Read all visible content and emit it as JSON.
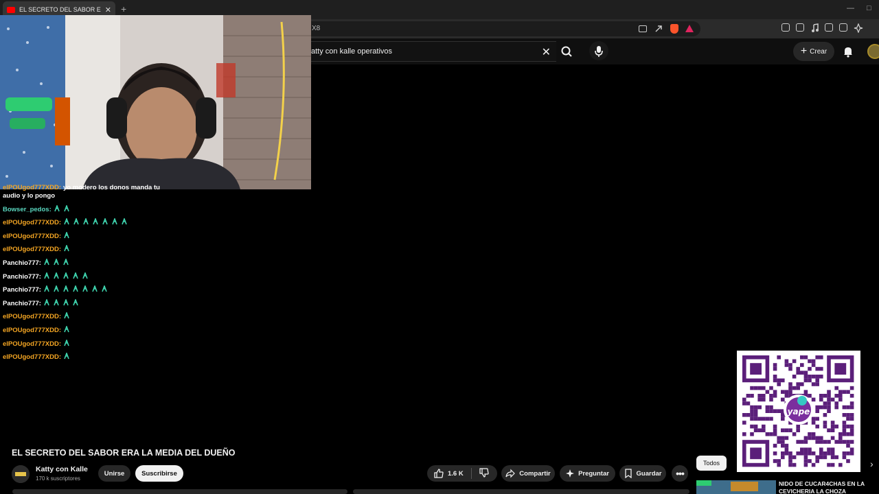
{
  "browser": {
    "tab_title": "EL SECRETO DEL SABOR ERA LA M",
    "tab_close": "✕",
    "new_tab": "+",
    "url_fragment": "X8"
  },
  "youtube": {
    "search_query": "atty con kalle operativos",
    "create_label": "Crear",
    "video_title": "EL SECRETO DEL SABOR ERA LA MEDIA DEL DUEÑO",
    "channel_name": "Katty con Kalle",
    "subscribers": "170 k suscriptores",
    "join_label": "Unirse",
    "subscribe_label": "Suscribirse",
    "like_count": "1.6 K",
    "share_label": "Compartir",
    "ask_label": "Preguntar",
    "save_label": "Guardar",
    "filter_all": "Todos",
    "recommended_title": "NIDO DE CUCAR4CHAS EN LA CEVICHERIA LA  CHOZA"
  },
  "chat": {
    "messages": [
      {
        "user": "elPOUgod777XDD:",
        "color": "orange",
        "text": "yo modero los donos manda tu audio y lo pongo",
        "emotes": 0
      },
      {
        "user": "Bowser_pedos:",
        "color": "green",
        "text": "",
        "emotes": 2
      },
      {
        "user": "elPOUgod777XDD:",
        "color": "orange",
        "text": "",
        "emotes": 7
      },
      {
        "user": "elPOUgod777XDD:",
        "color": "orange",
        "text": "",
        "emotes": 1
      },
      {
        "user": "elPOUgod777XDD:",
        "color": "orange",
        "text": "",
        "emotes": 1
      },
      {
        "user": "Panchio777:",
        "color": "white",
        "text": "",
        "emotes": 3
      },
      {
        "user": "Panchio777:",
        "color": "white",
        "text": "",
        "emotes": 5
      },
      {
        "user": "Panchio777:",
        "color": "white",
        "text": "",
        "emotes": 7
      },
      {
        "user": "Panchio777:",
        "color": "white",
        "text": "",
        "emotes": 4
      },
      {
        "user": "elPOUgod777XDD:",
        "color": "orange",
        "text": "",
        "emotes": 1
      },
      {
        "user": "elPOUgod777XDD:",
        "color": "orange",
        "text": "",
        "emotes": 1
      },
      {
        "user": "elPOUgod777XDD:",
        "color": "orange",
        "text": "",
        "emotes": 1
      },
      {
        "user": "elPOUgod777XDD:",
        "color": "orange",
        "text": "",
        "emotes": 1
      }
    ]
  },
  "colors": {
    "accent_orange": "#f5a623",
    "accent_green": "#5ad8c0",
    "emote_teal": "#3fd6b0",
    "qr_purple": "#5b1f7a"
  }
}
